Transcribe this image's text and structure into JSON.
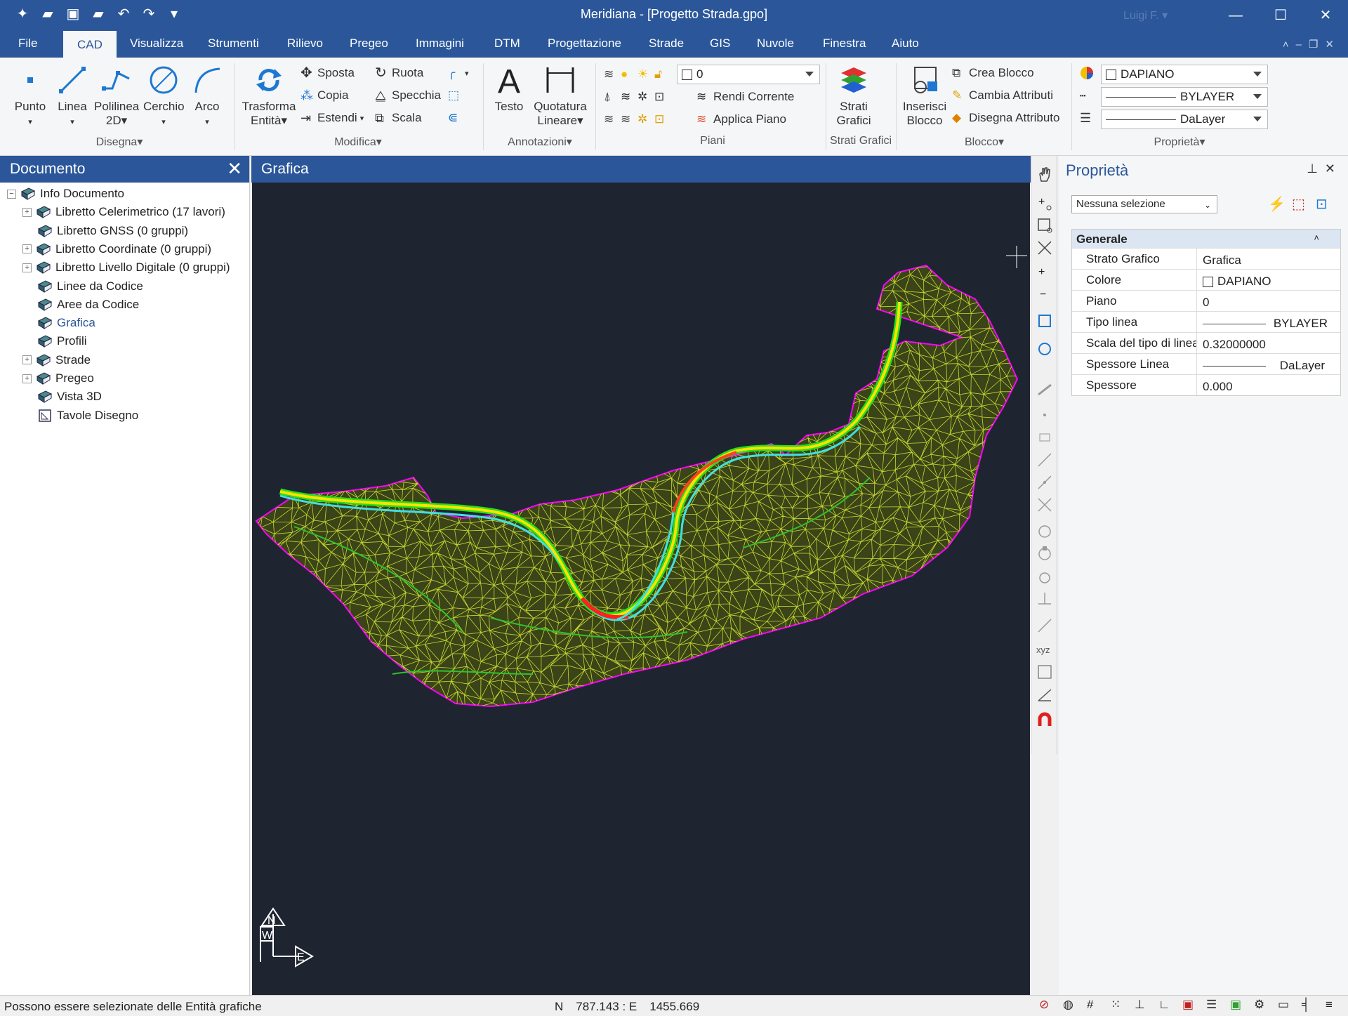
{
  "window": {
    "title": "Meridiana - [Progetto Strada.gpo]",
    "user": "Luigi F. ▾"
  },
  "menu": [
    "File",
    "CAD",
    "Visualizza",
    "Strumenti",
    "Rilievo",
    "Pregeo",
    "Immagini",
    "DTM",
    "Progettazione",
    "Strade",
    "GIS",
    "Nuvole",
    "Finestra",
    "Aiuto"
  ],
  "ribbon": {
    "disegna": {
      "label": "Disegna▾",
      "punto": "Punto",
      "linea": "Linea",
      "polilinea": "Polilinea",
      "polilinea2": "2D▾",
      "cerchio": "Cerchio",
      "arco": "Arco"
    },
    "modifica": {
      "label": "Modifica▾",
      "trasforma": "Trasforma",
      "trasforma2": "Entità▾",
      "sposta": "Sposta",
      "copia": "Copia",
      "estendi": "Estendi",
      "ruota": "Ruota",
      "specchia": "Specchia",
      "scala": "Scala"
    },
    "annotazioni": {
      "label": "Annotazioni▾",
      "testo": "Testo",
      "quotatura": "Quotatura",
      "quotatura2": "Lineare▾"
    },
    "piani": {
      "label": "Piani",
      "combo": "0",
      "rendi": "Rendi Corrente",
      "applica": "Applica Piano"
    },
    "strati": {
      "label": "Strati Grafici",
      "btn": "Strati",
      "btn2": "Grafici"
    },
    "blocco": {
      "label": "Blocco▾",
      "inserisci": "Inserisci",
      "inserisci2": "Blocco",
      "crea": "Crea Blocco",
      "cambia": "Cambia Attributi",
      "disegna": "Disegna Attributo"
    },
    "proprieta": {
      "label": "Proprietà▾",
      "color": "DAPIANO",
      "linetype": "BYLAYER",
      "lineweight": "DaLayer"
    }
  },
  "doc_panel": {
    "title": "Documento",
    "items": [
      {
        "label": "Info Documento",
        "exp": "−"
      },
      {
        "label": "Libretto Celerimetrico (17 lavori)",
        "exp": "+"
      },
      {
        "label": "Libretto GNSS (0 gruppi)",
        "exp": ""
      },
      {
        "label": "Libretto Coordinate (0 gruppi)",
        "exp": "+"
      },
      {
        "label": "Libretto Livello Digitale (0 gruppi)",
        "exp": "+"
      },
      {
        "label": "Linee da Codice",
        "exp": ""
      },
      {
        "label": "Aree da Codice",
        "exp": ""
      },
      {
        "label": "Grafica",
        "exp": ""
      },
      {
        "label": "Profili",
        "exp": ""
      },
      {
        "label": "Strade",
        "exp": "+"
      },
      {
        "label": "Pregeo",
        "exp": "+"
      },
      {
        "label": "Vista 3D",
        "exp": ""
      },
      {
        "label": "Tavole Disegno",
        "exp": ""
      }
    ]
  },
  "grafica": {
    "title": "Grafica",
    "compass_n": "N",
    "compass_w": "W",
    "compass_e": "E"
  },
  "props": {
    "title": "Proprietà",
    "selection": "Nessuna selezione",
    "group": "Generale",
    "collapse": "˄",
    "rows": [
      {
        "k": "Strato Grafico",
        "v": "Grafica"
      },
      {
        "k": "Colore",
        "v": "DAPIANO"
      },
      {
        "k": "Piano",
        "v": "0"
      },
      {
        "k": "Tipo linea",
        "v": "BYLAYER"
      },
      {
        "k": "Scala del tipo di linea",
        "v": "0.32000000"
      },
      {
        "k": "Spessore Linea",
        "v": "DaLayer"
      },
      {
        "k": "Spessore",
        "v": "0.000"
      }
    ]
  },
  "status": {
    "message": "Possono essere selezionate delle Entità grafiche",
    "n_label": "N",
    "n_value": "787.143 : E",
    "e_value": "1455.669"
  },
  "colors": {
    "accent": "#2b579a",
    "canvas": "#1f2530",
    "mesh": "#c8d830",
    "road": "#ffe000",
    "edge": "#ff00ff"
  }
}
